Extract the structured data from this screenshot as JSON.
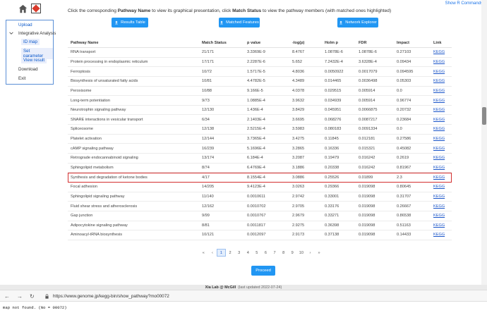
{
  "app": {
    "home_icon": "home-icon",
    "logo_icon": "app-logo-icon",
    "r_commands": "Show R Commands"
  },
  "sidebar": {
    "items": [
      {
        "label": "Upload"
      },
      {
        "label": "Integrative Analysis"
      },
      {
        "label": "Download"
      },
      {
        "label": "Exit"
      }
    ],
    "subitems": [
      {
        "label": "ID map"
      },
      {
        "label": "Set parameter"
      },
      {
        "label": "View result"
      }
    ]
  },
  "instructions": {
    "part1": "Click the corresponding ",
    "bold1": "Pathway Name",
    "part2": " to view its graphical presentation, click ",
    "bold2": "Match Status",
    "part3": " to view the pathway members (with matched ones highlighted)"
  },
  "buttons": {
    "results_table": "Results Table",
    "matched_features": "Matched Features",
    "network_explorer": "Network Explorer",
    "proceed": "Proceed"
  },
  "table": {
    "headers": [
      "Pathway Name",
      "Match Status",
      "p value",
      "-log(p)",
      "Holm p",
      "FDR",
      "Impact",
      "Link"
    ],
    "rows": [
      [
        "RNA transport",
        "21/171",
        "3.3369E-9",
        "8.4767",
        "1.0878E-6",
        "1.0878E-6",
        "0.27103",
        "KEGG"
      ],
      [
        "Protein processing in endoplasmic reticulum",
        "17/171",
        "2.2287E-6",
        "5.652",
        "7.2432E-4",
        "3.6328E-4",
        "0.09434",
        "KEGG"
      ],
      [
        "Ferroptosis",
        "10/72",
        "1.5717E-5",
        "4.8036",
        "0.0050922",
        "0.0017079",
        "0.094595",
        "KEGG"
      ],
      [
        "Biosynthesis of unsaturated fatty acids",
        "10/81",
        "4.4782E-5",
        "4.3489",
        "0.014465",
        "0.0036498",
        "0.05303",
        "KEGG"
      ],
      [
        "Peroxisome",
        "10/88",
        "9.166E-5",
        "4.0378",
        "0.029515",
        "0.005914",
        "0.0",
        "KEGG"
      ],
      [
        "Long-term potentiation",
        "9/73",
        "1.0885E-4",
        "3.9632",
        "0.034939",
        "0.005914",
        "0.96774",
        "KEGG"
      ],
      [
        "Neurotrophin signaling pathway",
        "12/130",
        "1.436E-4",
        "3.8429",
        "0.045951",
        "0.0066875",
        "0.20732",
        "KEGG"
      ],
      [
        "SNARE interactions in vesicular transport",
        "6/34",
        "2.1403E-4",
        "3.6695",
        "0.068276",
        "0.0087217",
        "0.23684",
        "KEGG"
      ],
      [
        "Spliceosome",
        "12/138",
        "2.5215E-4",
        "3.5983",
        "0.080183",
        "0.0091334",
        "0.0",
        "KEGG"
      ],
      [
        "Platelet activation",
        "12/144",
        "3.7365E-4",
        "3.4275",
        "0.11845",
        "0.012181",
        "0.27586",
        "KEGG"
      ],
      [
        "cAMP signaling pathway",
        "16/239",
        "5.1696E-4",
        "3.2865",
        "0.16336",
        "0.015321",
        "0.45082",
        "KEGG"
      ],
      [
        "Retrograde endocannabinoid signaling",
        "13/174",
        "6.184E-4",
        "3.2087",
        "0.19479",
        "0.016242",
        "0.2619",
        "KEGG"
      ],
      [
        "Sphingolipid metabolism",
        "8/74",
        "6.4769E-4",
        "3.1886",
        "0.20338",
        "0.016242",
        "0.81967",
        "KEGG"
      ],
      [
        "Synthesis and degradation of ketone bodies",
        "4/17",
        "8.1554E-4",
        "3.0886",
        "0.25526",
        "0.01899",
        "2.3",
        "KEGG"
      ],
      [
        "Focal adhesion",
        "14/205",
        "9.4123E-4",
        "3.0263",
        "0.29366",
        "0.019098",
        "0.80645",
        "KEGG"
      ],
      [
        "Sphingolipid signaling pathway",
        "11/140",
        "0.0010611",
        "2.9742",
        "0.33001",
        "0.019098",
        "0.31707",
        "KEGG"
      ],
      [
        "Fluid shear stress and atherosclerosis",
        "12/162",
        "0.0010702",
        "2.9705",
        "0.33176",
        "0.019098",
        "0.26667",
        "KEGG"
      ],
      [
        "Gap junction",
        "9/99",
        "0.0010767",
        "2.9679",
        "0.33271",
        "0.019098",
        "0.86538",
        "KEGG"
      ],
      [
        "Adipocytokine signaling pathway",
        "8/81",
        "0.0011817",
        "2.9275",
        "0.36398",
        "0.019098",
        "0.51163",
        "KEGG"
      ],
      [
        "Aminoacyl-tRNA biosynthesis",
        "10/121",
        "0.0012097",
        "2.9173",
        "0.37138",
        "0.019098",
        "0.14433",
        "KEGG"
      ]
    ],
    "highlighted_row": "Synthesis and degradation of ketone bodies"
  },
  "pager": {
    "first": "«",
    "prev": "‹",
    "pages": [
      "1",
      "2",
      "3",
      "4",
      "5",
      "6",
      "7",
      "8",
      "9",
      "10"
    ],
    "next": "›",
    "last": "»",
    "current": "1"
  },
  "footer": {
    "brand": "Xia Lab @ McGill",
    "updated": "(last updated 2022-07-24)"
  },
  "browser2": {
    "url": "https://www.genome.jp/kegg-bin/show_pathway?mo00072",
    "message": "map not found. (No = 00072)"
  },
  "colors": {
    "accent": "#2196f3",
    "link": "#1a55c9",
    "highlight_border": "#d32f2f"
  }
}
